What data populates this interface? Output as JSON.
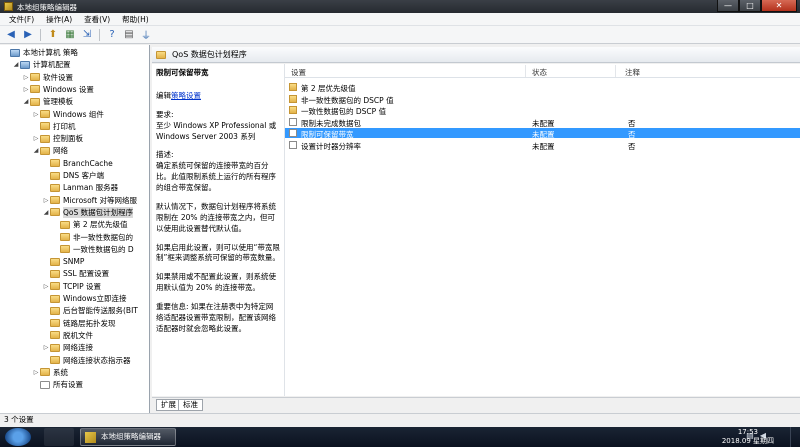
{
  "window": {
    "title": "本地组策略编辑器",
    "min": "—",
    "max": "□",
    "close": "✕"
  },
  "menu": [
    "文件(F)",
    "操作(A)",
    "查看(V)",
    "帮助(H)"
  ],
  "toolbar": [
    {
      "name": "back-icon",
      "glyph": "◀"
    },
    {
      "name": "forward-icon",
      "glyph": "▶"
    },
    {
      "name": "up-folder-icon",
      "glyph": "⬆"
    },
    {
      "name": "console-tree-icon",
      "glyph": "▦"
    },
    {
      "name": "export-icon",
      "glyph": "⇲"
    },
    {
      "name": "help-icon",
      "glyph": "?"
    },
    {
      "name": "properties-icon",
      "glyph": "▤"
    },
    {
      "name": "filter-icon",
      "glyph": "⏚"
    }
  ],
  "tree": [
    {
      "label": "本地计算机 策略",
      "depth": 0,
      "tw": "",
      "icon": "comp"
    },
    {
      "label": "计算机配置",
      "depth": 1,
      "tw": "◢",
      "icon": "comp"
    },
    {
      "label": "软件设置",
      "depth": 2,
      "tw": "▷",
      "icon": "folder"
    },
    {
      "label": "Windows 设置",
      "depth": 2,
      "tw": "▷",
      "icon": "folder"
    },
    {
      "label": "管理模板",
      "depth": 2,
      "tw": "◢",
      "icon": "folder"
    },
    {
      "label": "Windows 组件",
      "depth": 3,
      "tw": "▷",
      "icon": "folder"
    },
    {
      "label": "打印机",
      "depth": 3,
      "tw": "",
      "icon": "folder"
    },
    {
      "label": "控制面板",
      "depth": 3,
      "tw": "▷",
      "icon": "folder"
    },
    {
      "label": "网络",
      "depth": 3,
      "tw": "◢",
      "icon": "folder"
    },
    {
      "label": "BranchCache",
      "depth": 4,
      "tw": "",
      "icon": "folder"
    },
    {
      "label": "DNS 客户端",
      "depth": 4,
      "tw": "",
      "icon": "folder"
    },
    {
      "label": "Lanman 服务器",
      "depth": 4,
      "tw": "",
      "icon": "folder"
    },
    {
      "label": "Microsoft 对等网络服",
      "depth": 4,
      "tw": "▷",
      "icon": "folder"
    },
    {
      "label": "QoS 数据包计划程序",
      "depth": 4,
      "tw": "◢",
      "icon": "folder",
      "selected": true
    },
    {
      "label": "第 2 层优先级值",
      "depth": 5,
      "tw": "",
      "icon": "folder"
    },
    {
      "label": "非一致性数据包的",
      "depth": 5,
      "tw": "",
      "icon": "folder"
    },
    {
      "label": "一致性数据包的 D",
      "depth": 5,
      "tw": "",
      "icon": "folder"
    },
    {
      "label": "SNMP",
      "depth": 4,
      "tw": "",
      "icon": "folder"
    },
    {
      "label": "SSL 配置设置",
      "depth": 4,
      "tw": "",
      "icon": "folder"
    },
    {
      "label": "TCPIP 设置",
      "depth": 4,
      "tw": "▷",
      "icon": "folder"
    },
    {
      "label": "Windows立即连接",
      "depth": 4,
      "tw": "",
      "icon": "folder"
    },
    {
      "label": "后台智能传送服务(BIT",
      "depth": 4,
      "tw": "",
      "icon": "folder"
    },
    {
      "label": "链路层拓扑发现",
      "depth": 4,
      "tw": "",
      "icon": "folder"
    },
    {
      "label": "脱机文件",
      "depth": 4,
      "tw": "",
      "icon": "folder"
    },
    {
      "label": "网络连接",
      "depth": 4,
      "tw": "▷",
      "icon": "folder"
    },
    {
      "label": "网络连接状态指示器",
      "depth": 4,
      "tw": "",
      "icon": "folder"
    },
    {
      "label": "系统",
      "depth": 3,
      "tw": "▷",
      "icon": "folder"
    },
    {
      "label": "所有设置",
      "depth": 3,
      "tw": "",
      "icon": "doc"
    }
  ],
  "pane": {
    "header": "QoS 数据包计划程序"
  },
  "description": {
    "title": "限制可保留带宽",
    "edit_prefix": "编辑",
    "edit_link": "策略设置",
    "requirements_label": "要求:",
    "requirements": "至少 Windows XP Professional 或 Windows Server 2003 系列",
    "desc_label": "描述:",
    "desc": "确定系统可保留的连接带宽的百分比。此值限制系统上运行的所有程序的组合带宽保留。",
    "default": "默认情况下，数据包计划程序将系统限制在 20% 的连接带宽之内，但可以使用此设置替代默认值。",
    "enabled": "如果启用此设置，则可以使用“带宽限制”框来调整系统可保留的带宽数量。",
    "disabled": "如果禁用或不配置此设置，则系统使用默认值为 20% 的连接带宽。",
    "important": "重要信息: 如果在注册表中为特定网络适配器设置带宽限制，配置该网络适配器时就会忽略此设置。"
  },
  "list": {
    "col_setting": "设置",
    "col_state": "状态",
    "col_comment": "注释",
    "rows": [
      {
        "type": "folder",
        "name": "第 2 层优先级值",
        "state": "",
        "comment": ""
      },
      {
        "type": "folder",
        "name": "非一致性数据包的 DSCP 值",
        "state": "",
        "comment": ""
      },
      {
        "type": "folder",
        "name": "一致性数据包的 DSCP 值",
        "state": "",
        "comment": ""
      },
      {
        "type": "setting",
        "name": "限制未完成数据包",
        "state": "未配置",
        "comment": "否"
      },
      {
        "type": "setting",
        "name": "限制可保留带宽",
        "state": "未配置",
        "comment": "否",
        "selected": true
      },
      {
        "type": "setting",
        "name": "设置计时器分辨率",
        "state": "未配置",
        "comment": "否"
      }
    ]
  },
  "tabs": [
    "扩展",
    "标准"
  ],
  "status": "3 个设置",
  "taskbar": {
    "task_label": "本地组策略编辑器",
    "time": "17:53",
    "date": "2018.09 星期四"
  }
}
